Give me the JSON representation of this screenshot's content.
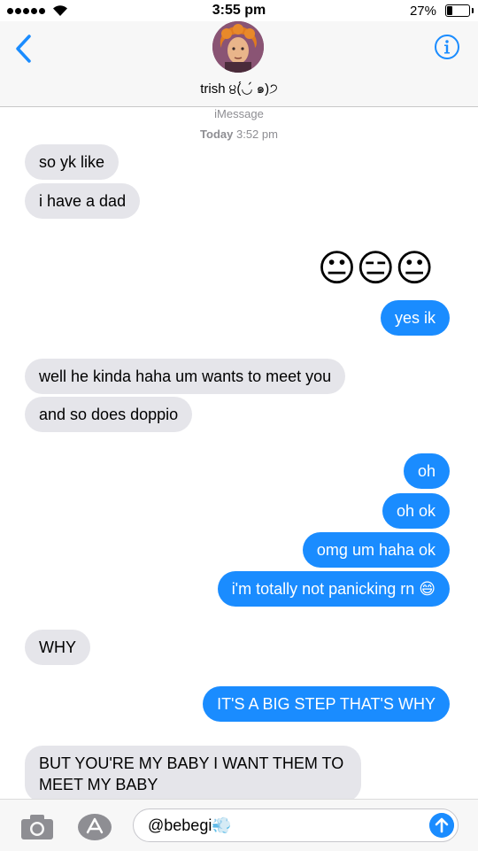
{
  "status_bar": {
    "time": "3:55 pm",
    "battery_percent": "27%",
    "battery_level": 0.27,
    "signal_bars": 5
  },
  "header": {
    "contact_name": "trish ੪(́◡́ ๑)੭"
  },
  "thread": {
    "service_label": "iMessage",
    "timestamp_day": "Today",
    "timestamp_time": "3:52 pm"
  },
  "messages": [
    {
      "direction": "incoming",
      "text": "so yk like"
    },
    {
      "direction": "incoming",
      "text": "i have a dad"
    },
    {
      "direction": "outgoing",
      "text": "😐😑😐"
    },
    {
      "direction": "outgoing",
      "text": "yes ik"
    },
    {
      "direction": "incoming",
      "text": "well he kinda haha um wants to meet you"
    },
    {
      "direction": "incoming",
      "text": "and so does doppio"
    },
    {
      "direction": "outgoing",
      "text": "oh"
    },
    {
      "direction": "outgoing",
      "text": "oh ok"
    },
    {
      "direction": "outgoing",
      "text": "omg um haha ok"
    },
    {
      "direction": "outgoing",
      "text": "i'm totally not panicking rn 😄"
    },
    {
      "direction": "incoming",
      "text": "WHY"
    },
    {
      "direction": "outgoing",
      "text": "IT'S A BIG STEP THAT'S WHY"
    },
    {
      "direction": "incoming",
      "text": "BUT YOU'RE MY BABY I WANT THEM TO MEET MY BABY"
    }
  ],
  "composer": {
    "value": "@bebegi💨"
  },
  "icons": {
    "back": "chevron-left-icon",
    "info": "info-icon",
    "camera": "camera-icon",
    "apps": "app-store-icon",
    "send": "arrow-up-icon"
  },
  "colors": {
    "accent": "#1a8cff",
    "incoming_bubble": "#e5e5ea",
    "meta_text": "#8e8e93"
  }
}
